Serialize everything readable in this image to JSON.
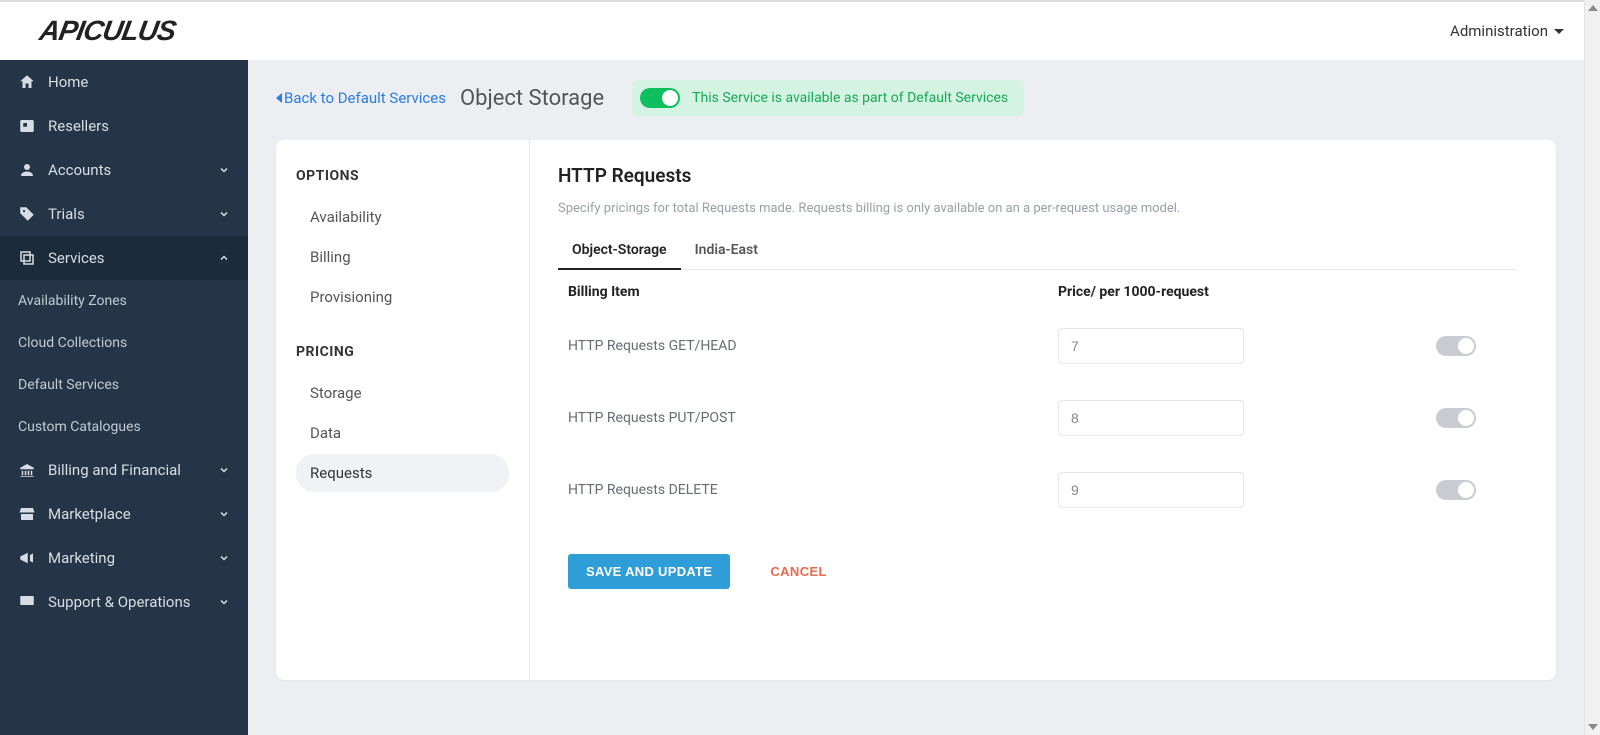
{
  "brand": "APICULUS",
  "header": {
    "admin_label": "Administration"
  },
  "sidebar": {
    "items": [
      {
        "label": "Home",
        "icon": "home-icon",
        "chev": null
      },
      {
        "label": "Resellers",
        "icon": "badge-icon",
        "chev": null
      },
      {
        "label": "Accounts",
        "icon": "user-icon",
        "chev": "down"
      },
      {
        "label": "Trials",
        "icon": "tag-icon",
        "chev": "down"
      },
      {
        "label": "Services",
        "icon": "layers-icon",
        "chev": "up",
        "active": true
      },
      {
        "label": "Billing and Financial",
        "icon": "bank-icon",
        "chev": "down"
      },
      {
        "label": "Marketplace",
        "icon": "store-icon",
        "chev": "down"
      },
      {
        "label": "Marketing",
        "icon": "megaphone-icon",
        "chev": "down"
      },
      {
        "label": "Support & Operations",
        "icon": "monitor-icon",
        "chev": "down"
      }
    ],
    "services_sub": [
      "Availability Zones",
      "Cloud Collections",
      "Default Services",
      "Custom Catalogues"
    ]
  },
  "page": {
    "back_label": "Back to Default Services",
    "title": "Object Storage",
    "availability_text": "This Service is available as part of Default Services"
  },
  "options": {
    "heading1": "OPTIONS",
    "items1": [
      "Availability",
      "Billing",
      "Provisioning"
    ],
    "heading2": "PRICING",
    "items2": [
      "Storage",
      "Data",
      "Requests"
    ],
    "active": "Requests"
  },
  "section": {
    "title": "HTTP Requests",
    "desc": "Specify pricings for total Requests made. Requests billing is only available on an a per-request usage model.",
    "tabs": [
      "Object-Storage",
      "India-East"
    ],
    "active_tab": "Object-Storage",
    "col_billing": "Billing Item",
    "col_price": "Price/ per 1000-request",
    "rows": [
      {
        "label": "HTTP Requests GET/HEAD",
        "value": "7"
      },
      {
        "label": "HTTP Requests PUT/POST",
        "value": "8"
      },
      {
        "label": "HTTP Requests DELETE",
        "value": "9"
      }
    ],
    "save_label": "SAVE AND UPDATE",
    "cancel_label": "CANCEL"
  }
}
